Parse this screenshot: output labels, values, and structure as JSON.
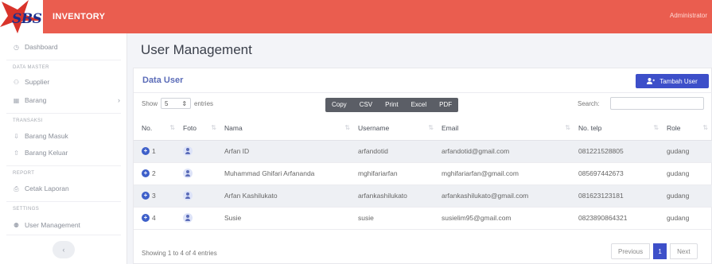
{
  "header": {
    "brand": "INVENTORY",
    "logo_text": "SBS",
    "user": "Administrator"
  },
  "sidebar": {
    "dashboard": "Dashboard",
    "sections": {
      "data_master": "DATA MASTER",
      "transaksi": "TRANSAKSI",
      "report": "REPORT",
      "settings": "SETTINGS"
    },
    "items": {
      "supplier": "Supplier",
      "barang": "Barang",
      "barang_masuk": "Barang Masuk",
      "barang_keluar": "Barang Keluar",
      "cetak_laporan": "Cetak Laporan",
      "user_management": "User Management"
    },
    "collapse": "‹"
  },
  "page": {
    "title": "User Management"
  },
  "card": {
    "title": "Data User",
    "add_button": "Tambah User",
    "show_label": "Show",
    "show_value": "5",
    "entries_label": "entries",
    "export_buttons": [
      "Copy",
      "CSV",
      "Print",
      "Excel",
      "PDF"
    ],
    "search_label": "Search:",
    "columns": [
      "No.",
      "Foto",
      "Nama",
      "Username",
      "Email",
      "No. telp",
      "Role"
    ],
    "rows": [
      {
        "no": "1",
        "nama": "Arfan ID",
        "username": "arfandotid",
        "email": "arfandotid@gmail.com",
        "telp": "081221528805",
        "role": "gudang"
      },
      {
        "no": "2",
        "nama": "Muhammad Ghifari Arfananda",
        "username": "mghifariarfan",
        "email": "mghifariarfan@gmail.com",
        "telp": "085697442673",
        "role": "gudang"
      },
      {
        "no": "3",
        "nama": "Arfan Kashilukato",
        "username": "arfankashilukato",
        "email": "arfankashilukato@gmail.com",
        "telp": "081623123181",
        "role": "gudang"
      },
      {
        "no": "4",
        "nama": "Susie",
        "username": "susie",
        "email": "susielim95@gmail.com",
        "telp": "0823890864321",
        "role": "gudang"
      }
    ],
    "info": "Showing 1 to 4 of 4 entries",
    "pager": {
      "prev": "Previous",
      "current": "1",
      "next": "Next"
    }
  },
  "colors": {
    "accent_red": "#ea5d4f",
    "primary_blue": "#3d4fc9",
    "title_blue": "#5b6cb8"
  }
}
